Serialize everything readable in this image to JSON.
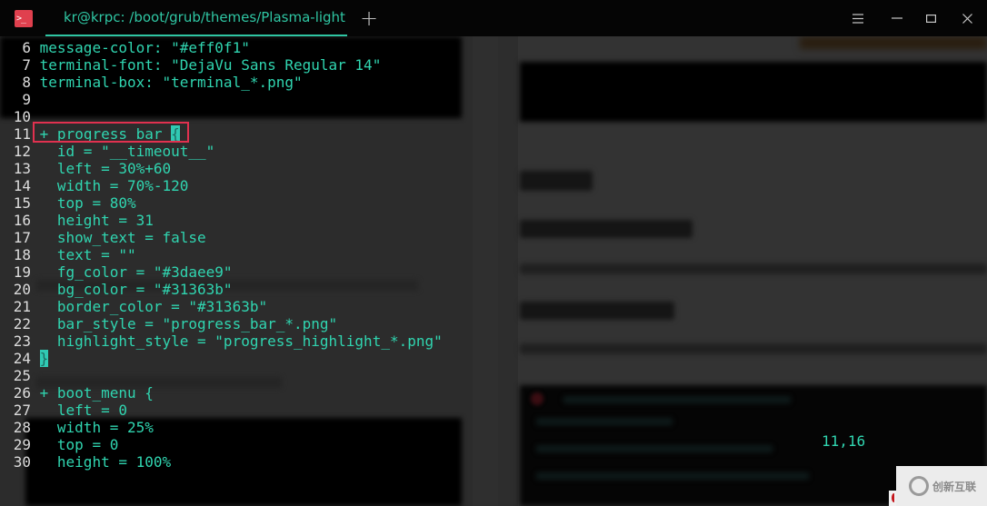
{
  "window": {
    "tab_title": "kr@krpc: /boot/grub/themes/Plasma-light",
    "app_icon_glyph": ">_",
    "new_tab_glyph": "+",
    "controls": [
      "menu-icon",
      "minimize-icon",
      "maximize-icon",
      "close-icon"
    ]
  },
  "editor": {
    "lines": [
      {
        "num": "6",
        "plus": "",
        "text": "message-color: \"#eff0f1\""
      },
      {
        "num": "7",
        "plus": "",
        "text": "terminal-font: \"DejaVu Sans Regular 14\""
      },
      {
        "num": "8",
        "plus": "",
        "text": "terminal-box: \"terminal_*.png\""
      },
      {
        "num": "9",
        "plus": "",
        "text": ""
      },
      {
        "num": "10",
        "plus": "",
        "text": ""
      },
      {
        "num": "11",
        "plus": "+",
        "text": "progress_bar ",
        "cursor": "{"
      },
      {
        "num": "12",
        "plus": "",
        "text": "  id = \"__timeout__\""
      },
      {
        "num": "13",
        "plus": "",
        "text": "  left = 30%+60"
      },
      {
        "num": "14",
        "plus": "",
        "text": "  width = 70%-120"
      },
      {
        "num": "15",
        "plus": "",
        "text": "  top = 80%"
      },
      {
        "num": "16",
        "plus": "",
        "text": "  height = 31"
      },
      {
        "num": "17",
        "plus": "",
        "text": "  show_text = false"
      },
      {
        "num": "18",
        "plus": "",
        "text": "  text = \"\""
      },
      {
        "num": "19",
        "plus": "",
        "text": "  fg_color = \"#3daee9\""
      },
      {
        "num": "20",
        "plus": "",
        "text": "  bg_color = \"#31363b\""
      },
      {
        "num": "21",
        "plus": "",
        "text": "  border_color = \"#31363b\""
      },
      {
        "num": "22",
        "plus": "",
        "text": "  bar_style = \"progress_bar_*.png\""
      },
      {
        "num": "23",
        "plus": "",
        "text": "  highlight_style = \"progress_highlight_*.png\""
      },
      {
        "num": "24",
        "plus": "",
        "text": "",
        "cursor": "}"
      },
      {
        "num": "25",
        "plus": "",
        "text": ""
      },
      {
        "num": "26",
        "plus": "+",
        "text": "boot_menu {"
      },
      {
        "num": "27",
        "plus": "",
        "text": "  left = 0"
      },
      {
        "num": "28",
        "plus": "",
        "text": "  width = 25%"
      },
      {
        "num": "29",
        "plus": "",
        "text": "  top = 0"
      },
      {
        "num": "30",
        "plus": "",
        "text": "  height = 100%"
      }
    ],
    "cursor_position": "11,16"
  },
  "watermark": {
    "text": "创新互联"
  },
  "colors": {
    "accent": "#2fc6a3",
    "code_text": "#30d5b0",
    "line_number": "#dcdcdc",
    "highlight_border": "#e0314f",
    "app_icon": "#e0404e"
  }
}
